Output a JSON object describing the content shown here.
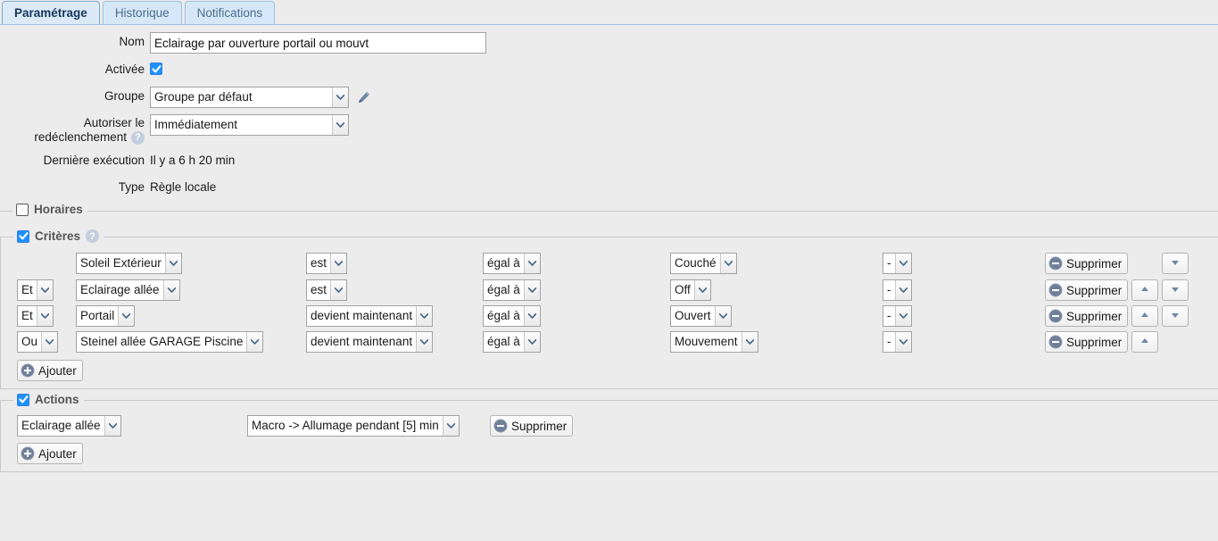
{
  "tabs": [
    {
      "label": "Paramétrage",
      "active": true
    },
    {
      "label": "Historique",
      "active": false
    },
    {
      "label": "Notifications",
      "active": false
    }
  ],
  "form": {
    "nom": {
      "label": "Nom",
      "value": "Eclairage par ouverture portail ou mouvt"
    },
    "activee": {
      "label": "Activée",
      "checked": true
    },
    "groupe": {
      "label": "Groupe",
      "value": "Groupe par défaut"
    },
    "redeclenchement": {
      "label_line1": "Autoriser le",
      "label_line2": "redéclenchement",
      "value": "Immédiatement",
      "help": "?"
    },
    "derniere_execution": {
      "label": "Dernière exécution",
      "value": "Il y a 6 h 20 min"
    },
    "type": {
      "label": "Type",
      "value": "Règle locale"
    }
  },
  "horaires": {
    "legend": "Horaires",
    "checked": false
  },
  "criteres": {
    "legend": "Critères",
    "checked": true,
    "help": "?",
    "rows": [
      {
        "logic": "",
        "object": "Soleil Extérieur",
        "operator": "est",
        "comparator": "égal à",
        "value": "Couché",
        "extra": "-",
        "delete_label": "Supprimer",
        "has_up": false,
        "has_down": true
      },
      {
        "logic": "Et",
        "object": "Eclairage allée",
        "operator": "est",
        "comparator": "égal à",
        "value": "Off",
        "extra": "-",
        "delete_label": "Supprimer",
        "has_up": true,
        "has_down": true
      },
      {
        "logic": "Et",
        "object": "Portail",
        "operator": "devient maintenant",
        "comparator": "égal à",
        "value": "Ouvert",
        "extra": "-",
        "delete_label": "Supprimer",
        "has_up": true,
        "has_down": true
      },
      {
        "logic": "Ou",
        "object": "Steinel allée GARAGE Piscine",
        "operator": "devient maintenant",
        "comparator": "égal à",
        "value": "Mouvement",
        "extra": "-",
        "delete_label": "Supprimer",
        "has_up": true,
        "has_down": false
      }
    ],
    "add_label": "Ajouter"
  },
  "actions": {
    "legend": "Actions",
    "checked": true,
    "rows": [
      {
        "object": "Eclairage allée",
        "command": "Macro -> Allumage pendant [5] min",
        "delete_label": "Supprimer"
      }
    ],
    "add_label": "Ajouter"
  },
  "colors": {
    "page_bg": "#ececec",
    "tab_active_bg": "#dceaf8",
    "tab_active_text": "#16365c",
    "tab_inactive_bg": "#d6e8f7",
    "tab_inactive_text": "#4a6c8c",
    "checkbox_blue": "#1e90ff",
    "icon_blue_grey": "#6f7f99",
    "border_grey": "#c9c9c9"
  }
}
